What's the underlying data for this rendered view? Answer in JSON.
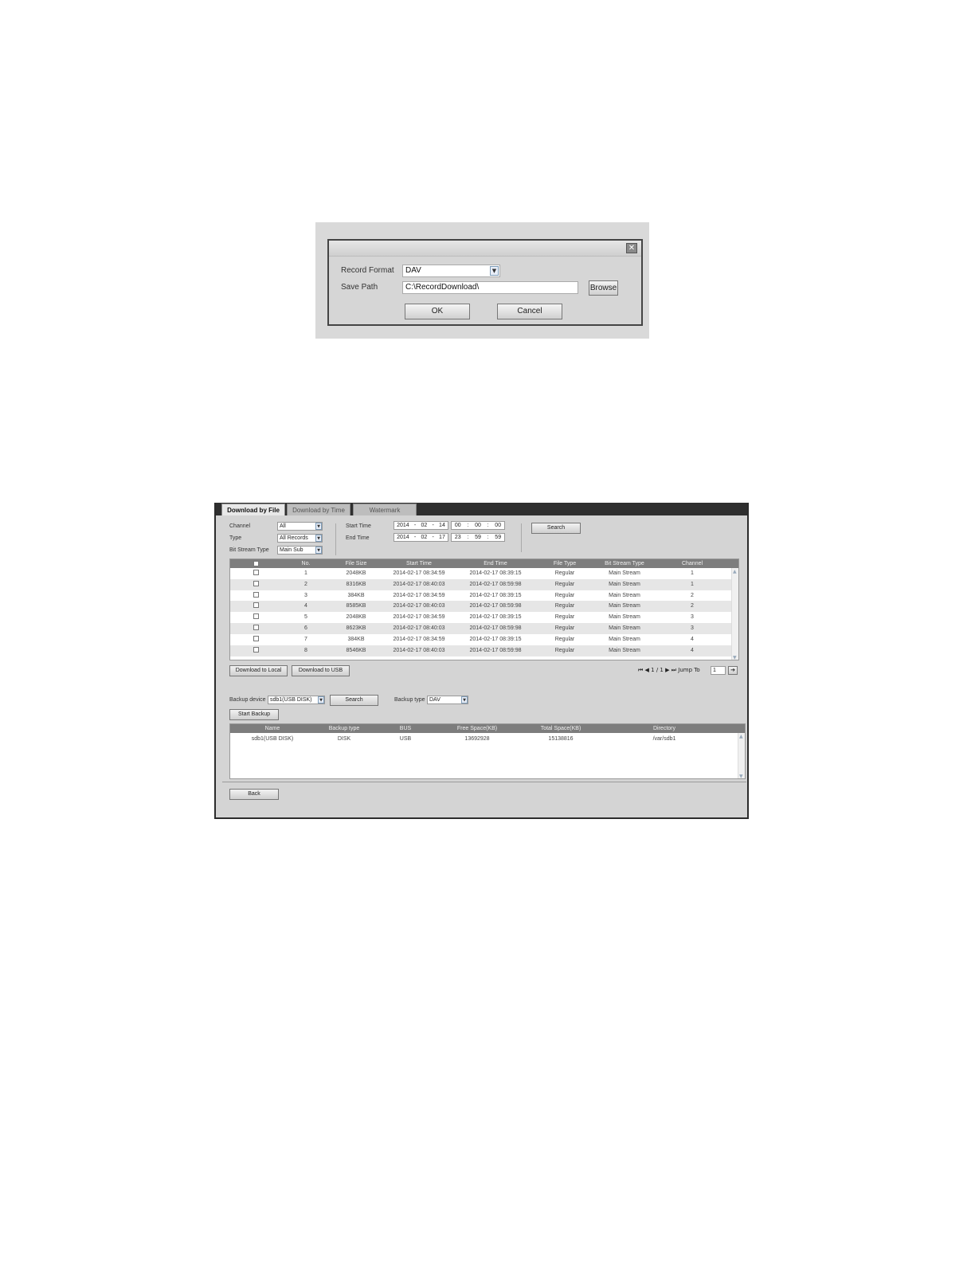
{
  "dialog": {
    "close_glyph": "✕",
    "record_format_label": "Record Format",
    "record_format_value": "DAV",
    "save_path_label": "Save Path",
    "save_path_value": "C:\\RecordDownload\\",
    "browse_label": "Browse",
    "ok_label": "OK",
    "cancel_label": "Cancel"
  },
  "panel": {
    "tabs": [
      "Download by File",
      "Download by Time",
      "Watermark"
    ],
    "filters": {
      "channel_label": "Channel",
      "channel_value": "All",
      "type_label": "Type",
      "type_value": "All Records",
      "bitstream_label": "Bit Stream Type",
      "bitstream_value": "Main Sub",
      "start_time_label": "Start Time",
      "start_date": [
        "2014",
        "-",
        "02",
        "-",
        "14"
      ],
      "start_clock": [
        "00",
        ":",
        "00",
        ":",
        "00"
      ],
      "end_time_label": "End Time",
      "end_date": [
        "2014",
        "-",
        "02",
        "-",
        "17"
      ],
      "end_clock": [
        "23",
        ":",
        "59",
        ":",
        "59"
      ],
      "search_label": "Search"
    },
    "file_table": {
      "headers": [
        "No.",
        "File Size",
        "Start Time",
        "End Time",
        "File Type",
        "Bit Stream Type",
        "Channel"
      ],
      "rows": [
        [
          "1",
          "2048KB",
          "2014-02-17 08:34:59",
          "2014-02-17 08:39:15",
          "Regular",
          "Main Stream",
          "1"
        ],
        [
          "2",
          "8316KB",
          "2014-02-17 08:40:03",
          "2014-02-17 08:59:98",
          "Regular",
          "Main Stream",
          "1"
        ],
        [
          "3",
          "384KB",
          "2014-02-17 08:34:59",
          "2014-02-17 08:39:15",
          "Regular",
          "Main Stream",
          "2"
        ],
        [
          "4",
          "8585KB",
          "2014-02-17 08:40:03",
          "2014-02-17 08:59:98",
          "Regular",
          "Main Stream",
          "2"
        ],
        [
          "5",
          "2048KB",
          "2014-02-17 08:34:59",
          "2014-02-17 08:39:15",
          "Regular",
          "Main Stream",
          "3"
        ],
        [
          "6",
          "8623KB",
          "2014-02-17 08:40:03",
          "2014-02-17 08:59:98",
          "Regular",
          "Main Stream",
          "3"
        ],
        [
          "7",
          "384KB",
          "2014-02-17 08:34:59",
          "2014-02-17 08:39:15",
          "Regular",
          "Main Stream",
          "4"
        ],
        [
          "8",
          "8546KB",
          "2014-02-17 08:40:03",
          "2014-02-17 08:59:98",
          "Regular",
          "Main Stream",
          "4"
        ]
      ]
    },
    "download_local_label": "Download to Local",
    "download_usb_label": "Download to USB",
    "pager": {
      "first_glyph": "⏮",
      "prev_glyph": "◀",
      "page_text": "1 / 1",
      "next_glyph": "▶",
      "last_glyph": "⏭",
      "jump_label": "Jump To",
      "jump_value": "1",
      "go_glyph": "➔"
    },
    "backup": {
      "device_label": "Backup device",
      "device_value": "sdb1(USB DISK)",
      "search_label": "Search",
      "type_label": "Backup type",
      "type_value": "DAV",
      "start_label": "Start Backup",
      "headers": [
        "Name",
        "Backup type",
        "BUS",
        "Free Space(KB)",
        "Total Space(KB)",
        "Directory"
      ],
      "rows": [
        [
          "sdb1(USB DISK)",
          "DISK",
          "USB",
          "13692928",
          "15138816",
          "/var/sdb1"
        ]
      ]
    },
    "back_label": "Back"
  }
}
